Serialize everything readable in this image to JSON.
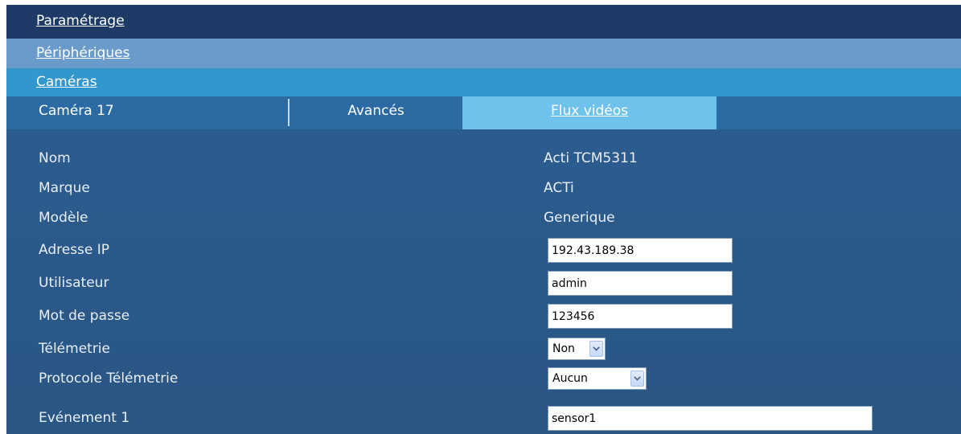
{
  "nav": {
    "level1": "Paramétrage",
    "level2": "Périphériques",
    "level3": "Caméras"
  },
  "tabs": {
    "camera": "Caméra 17",
    "avances": "Avancés",
    "flux": "Flux vidéos"
  },
  "form": {
    "nom": {
      "label": "Nom",
      "value": "Acti TCM5311"
    },
    "marque": {
      "label": "Marque",
      "value": "ACTi"
    },
    "modele": {
      "label": "Modèle",
      "value": "Generique"
    },
    "ip": {
      "label": "Adresse IP",
      "value": "192.43.189.38"
    },
    "user": {
      "label": "Utilisateur",
      "value": "admin"
    },
    "password": {
      "label": "Mot de passe",
      "value": "123456"
    },
    "telemetrie": {
      "label": "Télémetrie",
      "selected": "Non"
    },
    "protocole": {
      "label": "Protocole Télémetrie",
      "selected": "Aucun"
    },
    "evenement1": {
      "label": "Evénement 1",
      "value": "sensor1"
    }
  },
  "icons": {
    "dropdown": "chevron-down-icon"
  },
  "colors": {
    "nav1": "#1d3b66",
    "nav2": "#6a9bcb",
    "nav3": "#3197cd",
    "tabbar": "#2b6aa3",
    "tab_active": "#6fc2ec",
    "panel": "#2b5a8c"
  }
}
